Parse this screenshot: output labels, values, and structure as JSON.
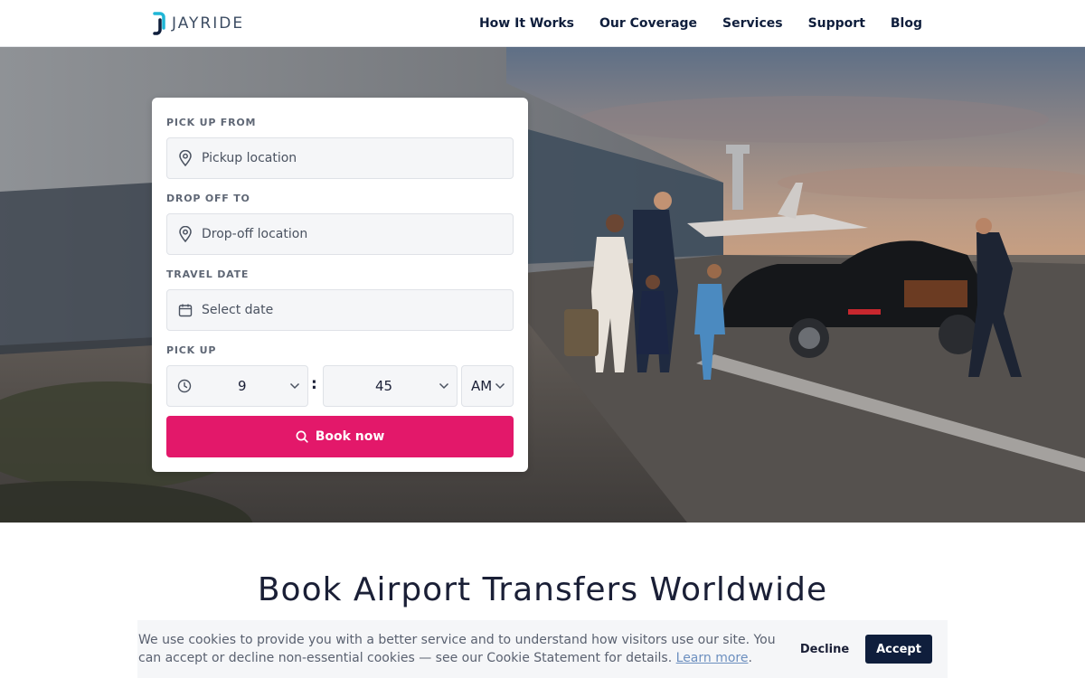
{
  "brand": {
    "name": "JAYRIDE",
    "accent": "#e3186a",
    "navy": "#0f1e3c",
    "logo_cyan": "#1fb6d6"
  },
  "nav": {
    "items": [
      "How It Works",
      "Our Coverage",
      "Services",
      "Support",
      "Blog"
    ]
  },
  "booking": {
    "pickup": {
      "label": "PICK UP FROM",
      "placeholder": "Pickup location",
      "icon": "map-pin-icon"
    },
    "dropoff": {
      "label": "DROP OFF TO",
      "placeholder": "Drop-off location",
      "icon": "map-pin-icon"
    },
    "date": {
      "label": "TRAVEL DATE",
      "placeholder": "Select date",
      "icon": "calendar-icon"
    },
    "time": {
      "label": "PICK UP",
      "hour": "9",
      "minute": "45",
      "period": "AM",
      "separator": ":",
      "icon": "clock-icon"
    },
    "submit_label": "Book now",
    "submit_icon": "search-icon"
  },
  "hero": {
    "image": "family walking to black sedan with chauffeur at airport terminal at sunset"
  },
  "main": {
    "title": "Book Airport Transfers Worldwide"
  },
  "cookie": {
    "text": "We use cookies to provide you with a better service and to understand how visitors use our site. You can accept or decline non-essential cookies — see our Cookie Statement for details.",
    "link": "Learn more",
    "suffix": ".",
    "decline": "Decline",
    "accept": "Accept"
  }
}
